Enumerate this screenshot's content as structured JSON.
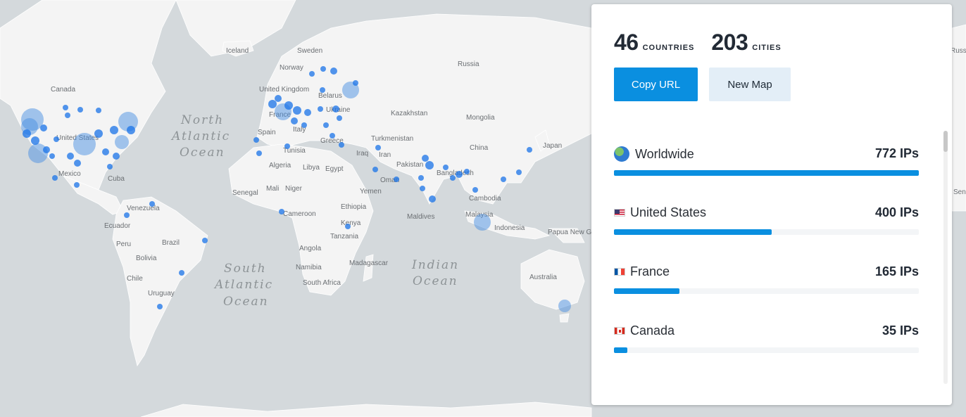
{
  "map": {
    "labels": {
      "iceland": "Iceland",
      "sweden": "Sweden",
      "norway": "Norway",
      "russia": "Russia",
      "canada": "Canada",
      "united_kingdom": "United Kingdom",
      "belarus": "Belarus",
      "ukraine": "Ukraine",
      "france": "France",
      "kazakhstan": "Kazakhstan",
      "mongolia": "Mongolia",
      "italy": "Italy",
      "spain": "Spain",
      "turkmenistan": "Turkmenistan",
      "china": "China",
      "japan": "Japan",
      "greece": "Greece",
      "united_states": "United States",
      "tunisia": "Tunisia",
      "iraq": "Iraq",
      "iran": "Iran",
      "pakistan": "Pakistan",
      "algeria": "Algeria",
      "libya": "Libya",
      "egypt": "Egypt",
      "bangladesh": "Bangladesh",
      "mexico": "Mexico",
      "cuba": "Cuba",
      "oman": "Oman",
      "senegal": "Senegal",
      "mali": "Mali",
      "niger": "Niger",
      "yemen": "Yemen",
      "cambodia": "Cambodia",
      "venezuela": "Venezuela",
      "cameroon": "Cameroon",
      "ethiopia": "Ethiopia",
      "maldives": "Maldives",
      "malaysia": "Malaysia",
      "ecuador": "Ecuador",
      "kenya": "Kenya",
      "indonesia": "Indonesia",
      "papua_new_guinea": "Papua New Guinea",
      "brazil": "Brazil",
      "peru": "Peru",
      "tanzania": "Tanzania",
      "angola": "Angola",
      "bolivia": "Bolivia",
      "madagascar": "Madagascar",
      "namibia": "Namibia",
      "australia": "Australia",
      "chile": "Chile",
      "south_africa": "South Africa",
      "uruguay": "Uruguay",
      "sen": "Sen",
      "russia_edge": "Russia"
    },
    "oceans": {
      "north_atlantic": [
        "North",
        "Atlantic",
        "Ocean"
      ],
      "south_atlantic": [
        "South",
        "Atlantic",
        "Ocean"
      ],
      "indian": [
        "Indian",
        "Ocean"
      ]
    }
  },
  "panel": {
    "countries_count": "46",
    "countries_label": "COUNTRIES",
    "cities_count": "203",
    "cities_label": "CITIES",
    "copy_url_label": "Copy URL",
    "new_map_label": "New Map",
    "rows": [
      {
        "name": "Worldwide",
        "count": "772 IPs",
        "fraction": 1.0,
        "icon": "globe-icon"
      },
      {
        "name": "United States",
        "count": "400 IPs",
        "fraction": 0.518,
        "icon": "us-flag-icon"
      },
      {
        "name": "France",
        "count": "165 IPs",
        "fraction": 0.214,
        "icon": "fr-flag-icon"
      },
      {
        "name": "Canada",
        "count": "35 IPs",
        "fraction": 0.045,
        "icon": "ca-flag-icon"
      }
    ],
    "accent_color": "#0a8fe0"
  }
}
